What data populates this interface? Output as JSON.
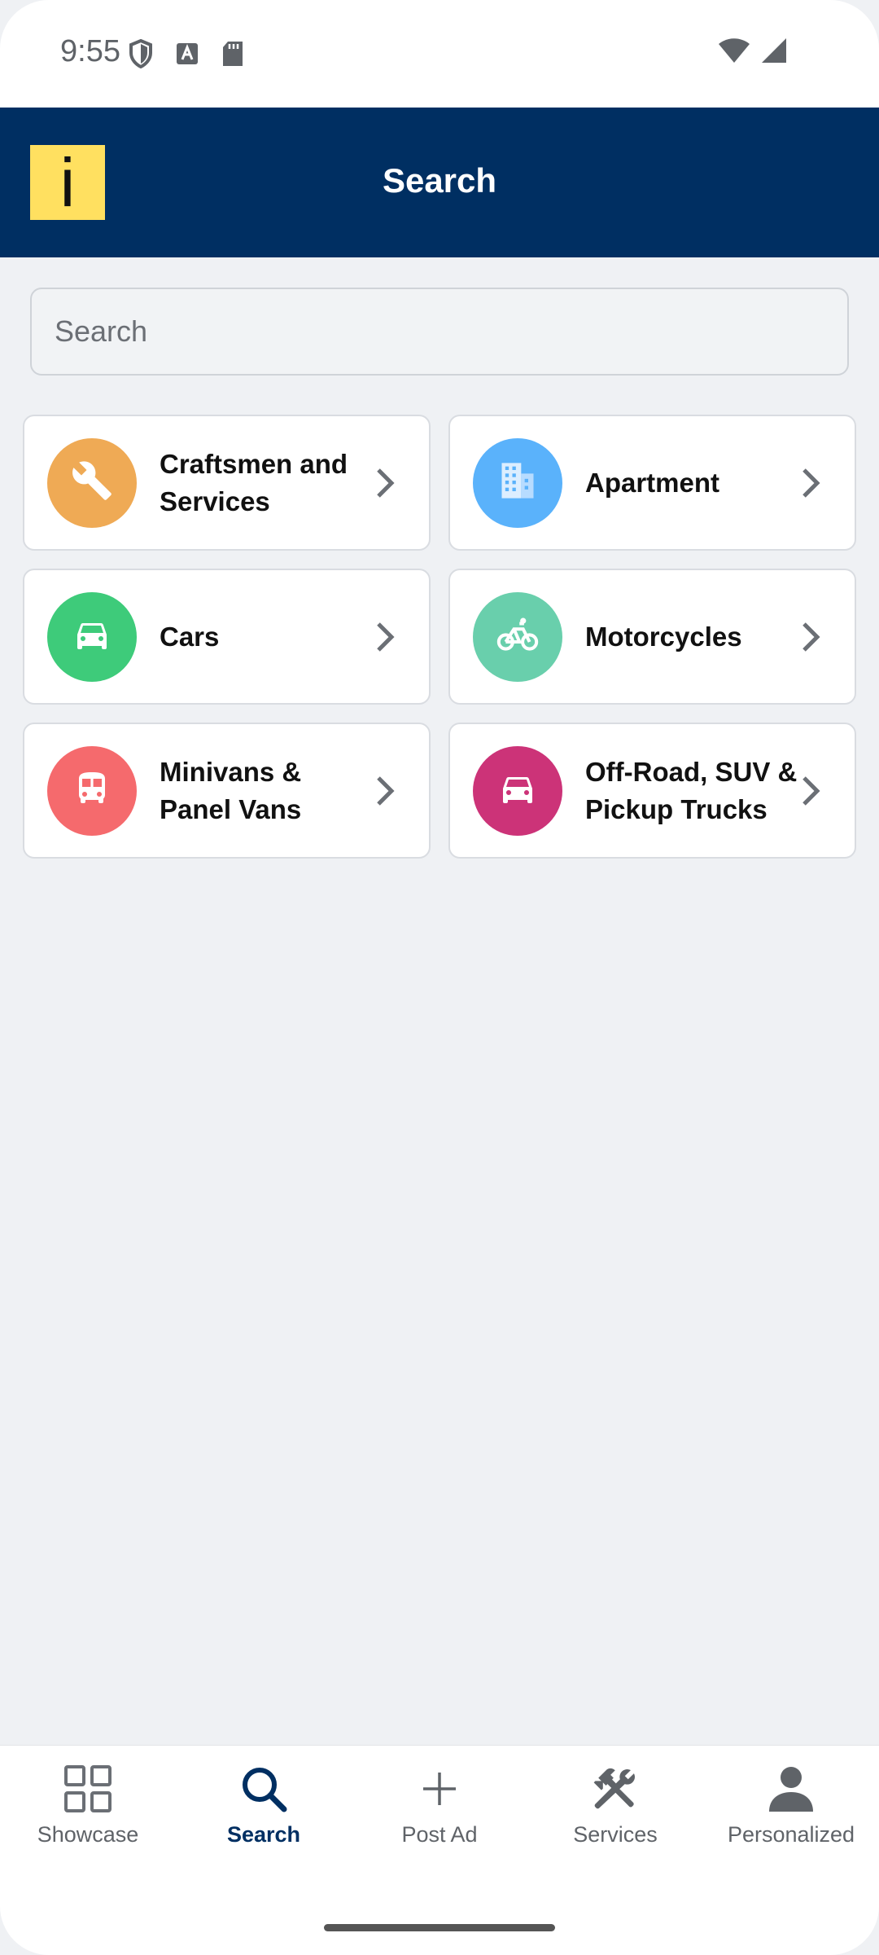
{
  "status_bar": {
    "time": "9:55",
    "icons_left": [
      "shield-icon",
      "font-download-icon",
      "sd-card-icon"
    ],
    "icons_right": [
      "wifi-icon",
      "signal-icon"
    ]
  },
  "app_bar": {
    "logo_text": "i",
    "title": "Search",
    "colors": {
      "background": "#002f62",
      "logo_bg": "#ffe060"
    }
  },
  "search": {
    "placeholder": "Search"
  },
  "categories": [
    {
      "label": "Craftsmen and Services",
      "icon": "wrench-icon",
      "color": "#efaa55"
    },
    {
      "label": "Apartment",
      "icon": "building-icon",
      "color": "#5ab2fb"
    },
    {
      "label": "Cars",
      "icon": "car-icon",
      "color": "#3ecb7a"
    },
    {
      "label": "Motorcycles",
      "icon": "bicycle-icon",
      "color": "#69cfac"
    },
    {
      "label": "Minivans & Panel Vans",
      "icon": "bus-icon",
      "color": "#f56a6d"
    },
    {
      "label": "Off-Road, SUV & Pickup Trucks",
      "icon": "car-icon",
      "color": "#cc3378"
    }
  ],
  "bottom_nav": {
    "items": [
      {
        "label": "Showcase",
        "icon": "grid-icon",
        "active": false
      },
      {
        "label": "Search",
        "icon": "search-icon",
        "active": true
      },
      {
        "label": "Post Ad",
        "icon": "plus-icon",
        "active": false
      },
      {
        "label": "Services",
        "icon": "tools-icon",
        "active": false
      },
      {
        "label": "Personalized",
        "icon": "person-icon",
        "active": false
      }
    ],
    "active_color": "#002f62"
  }
}
